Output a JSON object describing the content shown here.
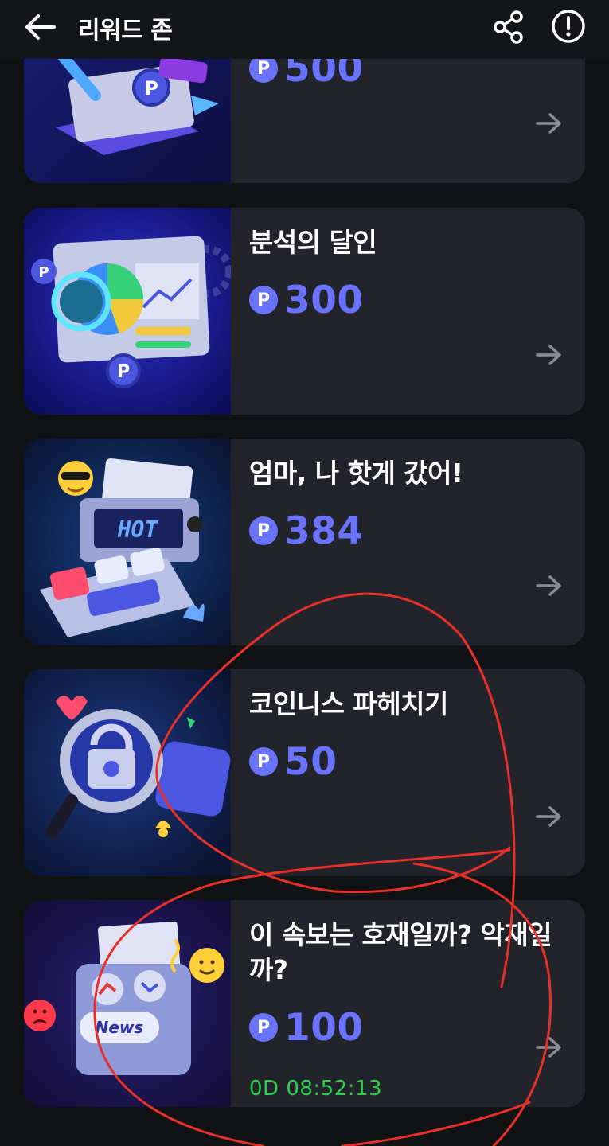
{
  "header": {
    "title": "리워드 존"
  },
  "cards": [
    {
      "name": "",
      "points": "500"
    },
    {
      "name": "분석의 달인",
      "points": "300"
    },
    {
      "name": "엄마, 나 핫게 갔어!",
      "points": "384",
      "thumb_text": "HOT"
    },
    {
      "name": "코인니스 파헤치기",
      "points": "50"
    },
    {
      "name": "이 속보는 호재일까? 악재일까?",
      "points": "100",
      "timer": "0D 08:52:13",
      "thumb_text": "News"
    }
  ],
  "icons": {
    "back": "arrow-left-icon",
    "share": "share-icon",
    "info": "exclamation-circle-icon",
    "coin": "point-coin-icon",
    "arrow": "arrow-right-icon"
  },
  "colors": {
    "background": "#111214",
    "card": "#23242b",
    "accent": "#6a73ff",
    "timer": "#2ad14a",
    "annotation": "#e8302a"
  }
}
